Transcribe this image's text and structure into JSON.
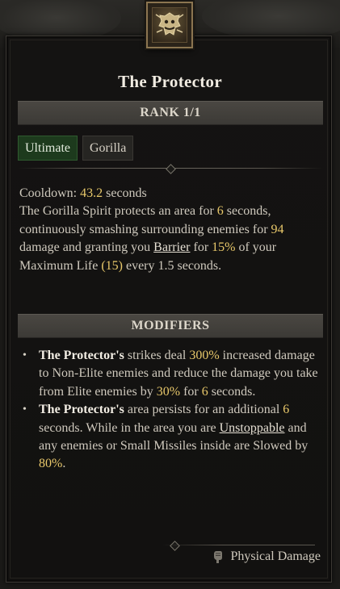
{
  "skill": {
    "name": "The Protector",
    "rank": "RANK 1/1",
    "tags": [
      "Ultimate",
      "Gorilla"
    ],
    "icon": "gorilla-skill-icon"
  },
  "description": {
    "cooldown_label": "Cooldown: ",
    "cooldown_value": "43.2",
    "cooldown_unit": " seconds",
    "t1": "The Gorilla Spirit protects an area for ",
    "v1": "6",
    "t2": " seconds, continuously smashing surrounding enemies for ",
    "v2": "94",
    "t3": " damage and granting you ",
    "kw1": "Barrier",
    "t4": " for ",
    "v3": "15%",
    "t5": " of your Maximum Life ",
    "v4": "(15)",
    "t6": " every 1.5 seconds."
  },
  "modifiers": {
    "header": "MODIFIERS",
    "m1": {
      "name": "The Protector's",
      "t1": " strikes deal ",
      "v1": "300%",
      "t2": " increased damage to Non-Elite enemies and reduce the damage you take from Elite enemies by ",
      "v2": "30%",
      "t3": " for ",
      "v3": "6",
      "t4": " seconds."
    },
    "m2": {
      "name": "The Protector's",
      "t1": " area persists for an additional ",
      "v1": "6",
      "t2": " seconds. While in the area you are ",
      "kw": "Unstoppable",
      "t3": " and any enemies or Small Missiles inside are Slowed by ",
      "v2": "80%",
      "t4": "."
    }
  },
  "footer": {
    "damage_type": "Physical Damage",
    "icon": "fist-icon"
  },
  "colors": {
    "value_gold": "#e8c86a",
    "ultimate_green": "#1d3a1d",
    "bar_gray": "#4a4742"
  }
}
